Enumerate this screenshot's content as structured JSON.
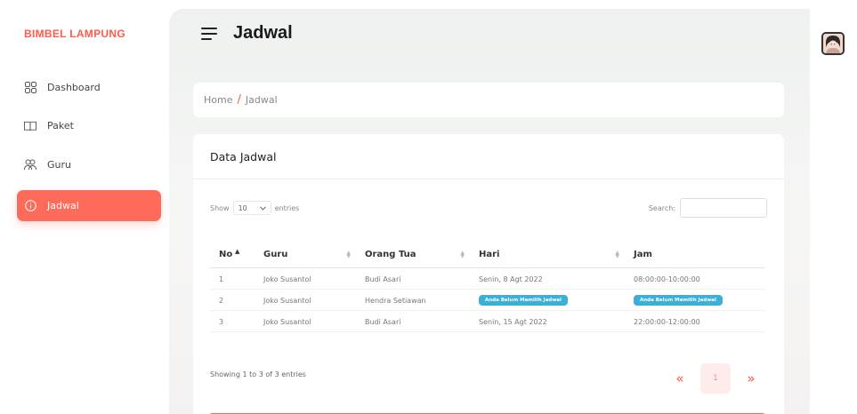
{
  "brand": "BIMBEL LAMPUNG",
  "sidebar": {
    "items": [
      {
        "label": "Dashboard",
        "icon": "grid-icon"
      },
      {
        "label": "Paket",
        "icon": "book-icon"
      },
      {
        "label": "Guru",
        "icon": "users-icon"
      },
      {
        "label": "Jadwal",
        "icon": "info-icon",
        "active": true
      }
    ]
  },
  "header": {
    "title": "Jadwal"
  },
  "breadcrumb": {
    "home": "Home",
    "separator": "/",
    "current": "Jadwal"
  },
  "card": {
    "title": "Data Jadwal"
  },
  "table_controls": {
    "show_label": "Show",
    "entries_value": "10",
    "entries_label": "entries",
    "search_label": "Search:",
    "search_value": ""
  },
  "table": {
    "headers": [
      "No",
      "Guru",
      "Orang Tua",
      "Hari",
      "Jam"
    ],
    "rows": [
      {
        "no": "1",
        "guru": "Joko Susantol",
        "orang_tua": "Budi Asari",
        "hari": "Senin, 8 Agt 2022",
        "jam": "08:00:00-10:00:00"
      },
      {
        "no": "2",
        "guru": "Joko Susantol",
        "orang_tua": "Hendra Setiawan",
        "hari": "Anda Belum Memilih Jadwal",
        "jam": "Anda Belum Memilih Jadwal"
      },
      {
        "no": "3",
        "guru": "Joko Susantol",
        "orang_tua": "Budi Asari",
        "hari": "Senin, 15 Agt 2022",
        "jam": "22:00:00-12:00:00"
      }
    ]
  },
  "info": "Showing 1 to 3 of 3 entries",
  "pagination": {
    "prev": "«",
    "current": "1",
    "next": "»"
  },
  "colors": {
    "accent": "#ff6b5a",
    "badge": "#3bafd6"
  }
}
